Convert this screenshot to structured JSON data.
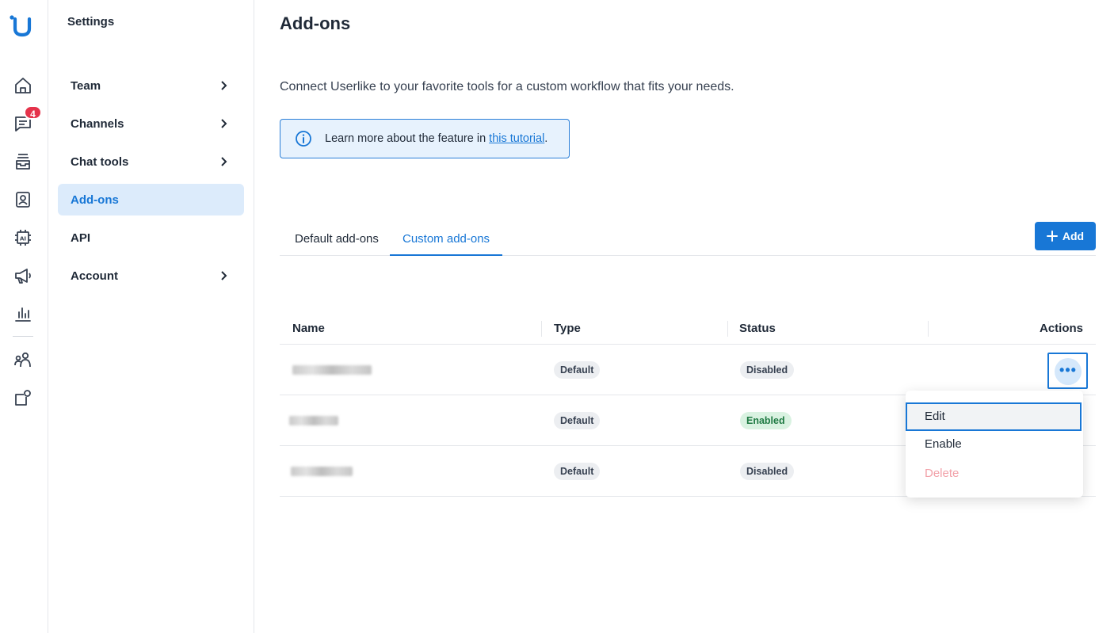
{
  "rail": {
    "notification_count": "4",
    "icons": [
      "home-icon",
      "chat-icon",
      "inbox-icon",
      "contacts-icon",
      "ai-icon",
      "megaphone-icon",
      "analytics-icon",
      "team-icon",
      "settings-icon"
    ]
  },
  "settings": {
    "title": "Settings",
    "items": [
      {
        "label": "Team",
        "has_chevron": true
      },
      {
        "label": "Channels",
        "has_chevron": true
      },
      {
        "label": "Chat tools",
        "has_chevron": true
      },
      {
        "label": "Add-ons",
        "has_chevron": false,
        "active": true
      },
      {
        "label": "API",
        "has_chevron": false
      },
      {
        "label": "Account",
        "has_chevron": true
      }
    ]
  },
  "main": {
    "title": "Add-ons",
    "description": "Connect Userlike to your favorite tools for a custom workflow that fits your needs.",
    "info": {
      "prefix": "Learn more about the feature in ",
      "link": "this tutorial",
      "suffix": "."
    },
    "tabs": [
      {
        "label": "Default add-ons",
        "active": false
      },
      {
        "label": "Custom add-ons",
        "active": true
      }
    ],
    "add_label": "Add",
    "table": {
      "headers": {
        "name": "Name",
        "type": "Type",
        "status": "Status",
        "actions": "Actions"
      },
      "rows": [
        {
          "type": "Default",
          "status": "Disabled"
        },
        {
          "type": "Default",
          "status": "Enabled"
        },
        {
          "type": "Default",
          "status": "Disabled"
        }
      ]
    },
    "menu": {
      "edit": "Edit",
      "enable": "Enable",
      "delete": "Delete"
    }
  },
  "colors": {
    "accent": "#1877d6",
    "active_bg": "#dcebfb",
    "badge": "#e5334b",
    "enabled_bg": "#d9f2e1",
    "danger_muted": "#f2a0a8"
  }
}
